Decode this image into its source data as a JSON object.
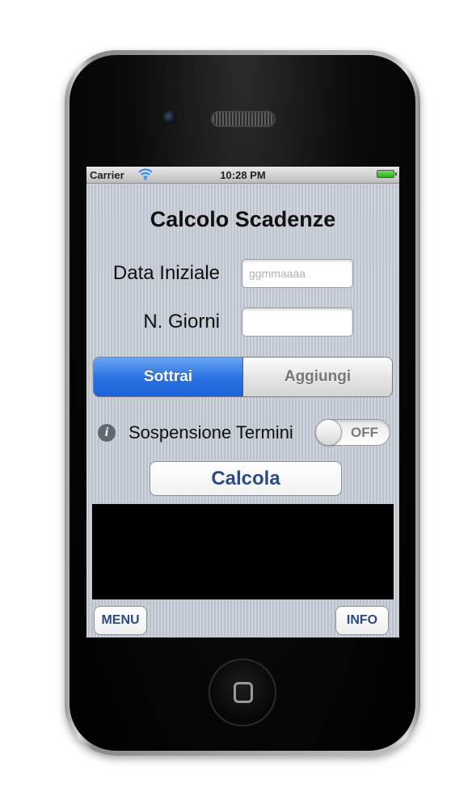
{
  "statusbar": {
    "carrier": "Carrier",
    "time": "10:28 PM",
    "wifi_icon": "wifi-icon",
    "battery_icon": "battery-icon"
  },
  "app": {
    "title": "Calcolo Scadenze",
    "data_iniziale": {
      "label": "Data Iniziale",
      "placeholder": "ggmmaaaa",
      "value": ""
    },
    "n_giorni": {
      "label": "N. Giorni",
      "placeholder": "",
      "value": ""
    },
    "segmented": {
      "options": [
        "Sottrai",
        "Aggiungi"
      ],
      "selected": "Sottrai"
    },
    "sospensione": {
      "info_icon": "info-icon",
      "label": "Sospensione Termini",
      "toggle_state": "OFF"
    },
    "calcola_label": "Calcola",
    "menu_label": "MENU",
    "info_label": "INFO"
  },
  "colors": {
    "segment_selected": "#2b74e4",
    "button_text": "#2c4a85",
    "result_background": "#000000"
  }
}
